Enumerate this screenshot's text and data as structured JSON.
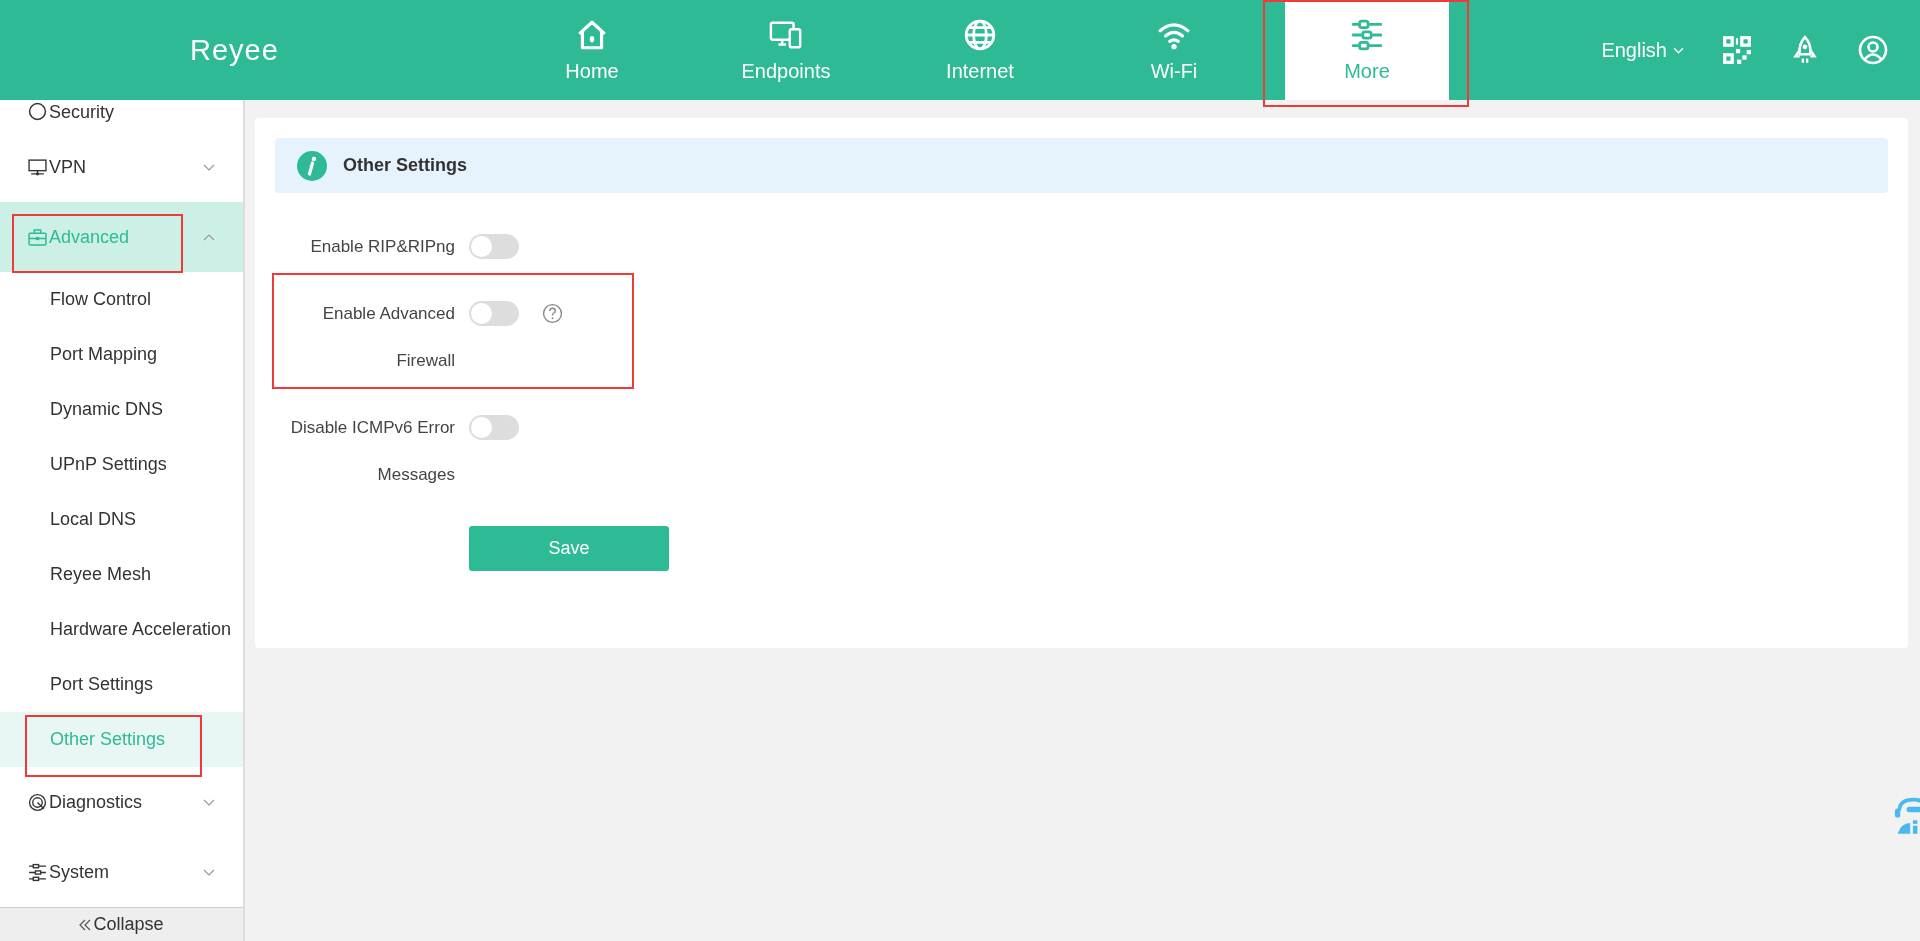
{
  "header": {
    "logo": "Reyee",
    "nav": [
      {
        "label": "Home",
        "selected": false,
        "highlighted": false
      },
      {
        "label": "Endpoints",
        "selected": false,
        "highlighted": false
      },
      {
        "label": "Internet",
        "selected": false,
        "highlighted": false
      },
      {
        "label": "Wi-Fi",
        "selected": false,
        "highlighted": false
      },
      {
        "label": "More",
        "selected": true,
        "highlighted": true
      }
    ],
    "language": "English"
  },
  "sidebar": {
    "items": [
      {
        "label": "Security",
        "selected": false,
        "highlighted": false
      },
      {
        "label": "VPN",
        "expanded": false,
        "selected": false,
        "highlighted": false
      },
      {
        "label": "Advanced",
        "expanded": true,
        "selected": true,
        "highlighted": true,
        "children": [
          {
            "label": "Flow Control",
            "selected": false,
            "highlighted": false
          },
          {
            "label": "Port Mapping",
            "selected": false,
            "highlighted": false
          },
          {
            "label": "Dynamic DNS",
            "selected": false,
            "highlighted": false
          },
          {
            "label": "UPnP Settings",
            "selected": false,
            "highlighted": false
          },
          {
            "label": "Local DNS",
            "selected": false,
            "highlighted": false
          },
          {
            "label": "Reyee Mesh",
            "selected": false,
            "highlighted": false
          },
          {
            "label": "Hardware Acceleration",
            "selected": false,
            "highlighted": false
          },
          {
            "label": "Port Settings",
            "selected": false,
            "highlighted": false
          },
          {
            "label": "Other Settings",
            "selected": true,
            "highlighted": true
          }
        ]
      },
      {
        "label": "Diagnostics",
        "expanded": false,
        "selected": false,
        "highlighted": false
      },
      {
        "label": "System",
        "expanded": false,
        "selected": false,
        "highlighted": false
      }
    ],
    "collapse": "Collapse"
  },
  "panel": {
    "title": "Other Settings",
    "settings": [
      {
        "label": "Enable RIP&RIPng",
        "on": false,
        "help": false,
        "highlighted": false
      },
      {
        "label": "Enable Advanced Firewall",
        "on": false,
        "help": true,
        "highlighted": true
      },
      {
        "label": "Disable ICMPv6 Error Messages",
        "on": false,
        "help": false,
        "highlighted": false
      }
    ],
    "save": "Save"
  }
}
